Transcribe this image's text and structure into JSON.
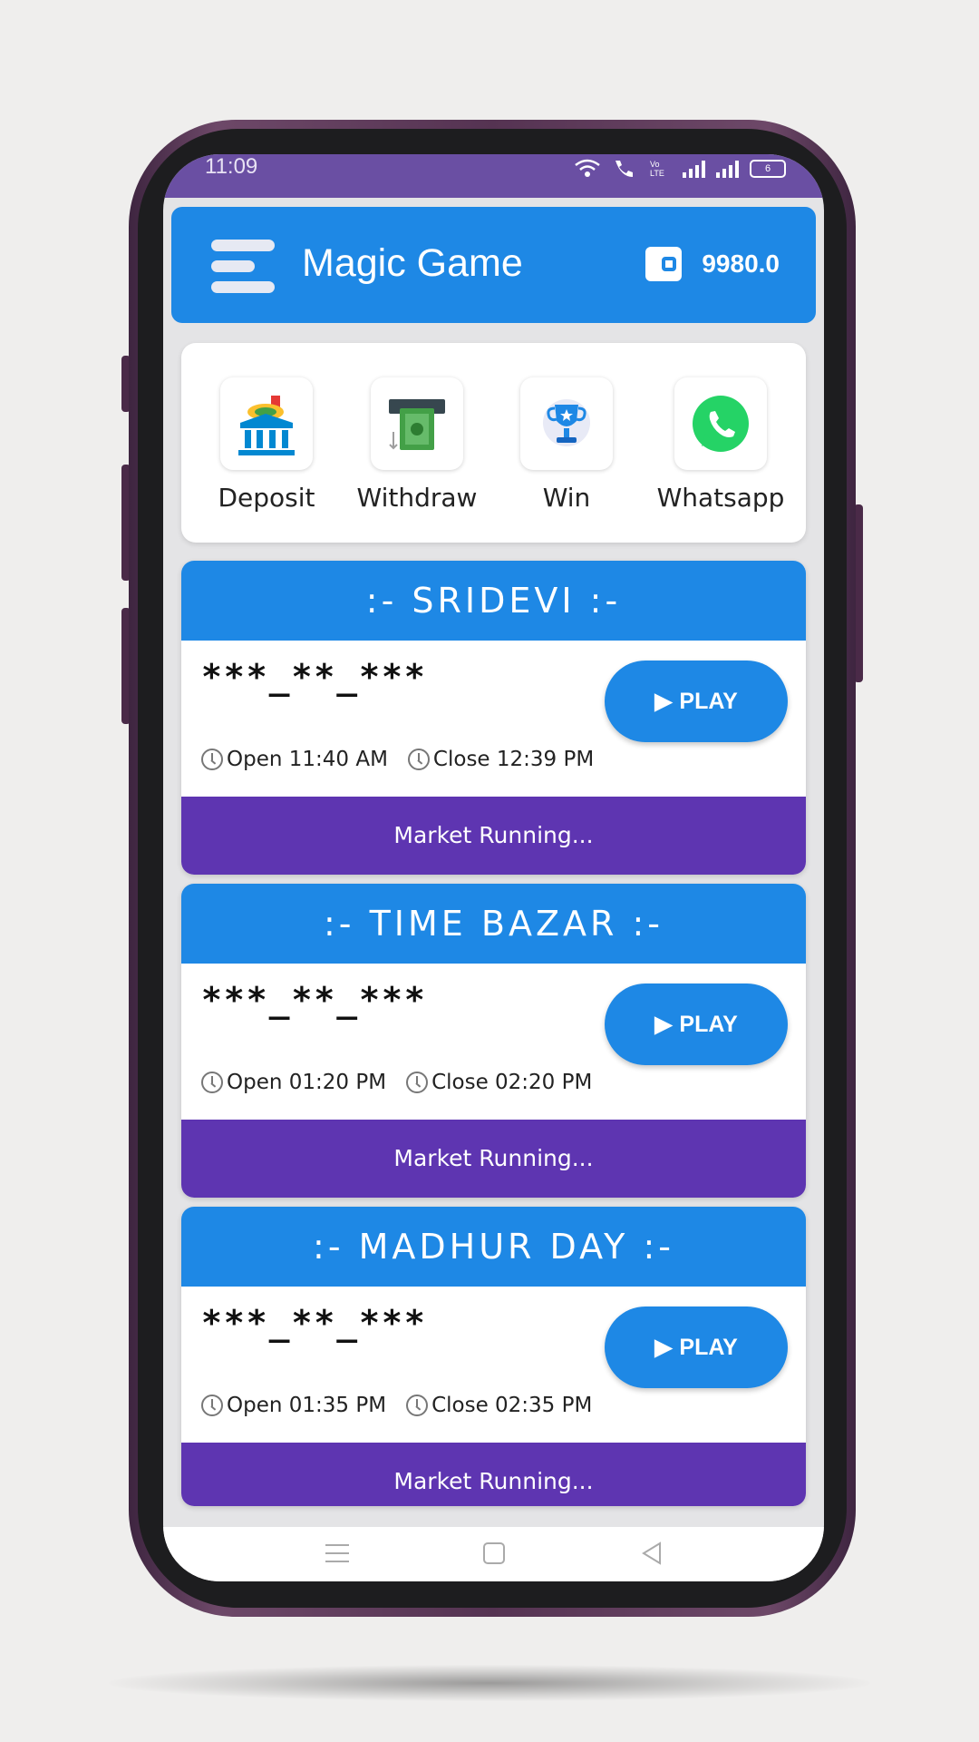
{
  "statusbar": {
    "time": "11:09",
    "battery": "6"
  },
  "header": {
    "title": "Magic Game",
    "wallet_balance": "9980.0"
  },
  "quick_actions": [
    {
      "label": "Deposit",
      "icon": "bank-deposit-icon"
    },
    {
      "label": "Withdraw",
      "icon": "atm-cash-icon"
    },
    {
      "label": "Win",
      "icon": "trophy-icon"
    },
    {
      "label": "Whatsapp",
      "icon": "whatsapp-icon"
    }
  ],
  "markets": [
    {
      "name": ":- SRIDEVI :-",
      "result": "***_**_***",
      "open": "Open 11:40 AM",
      "close": "Close 12:39 PM",
      "play": "PLAY",
      "status": "Market Running..."
    },
    {
      "name": ":- TIME BAZAR :-",
      "result": "***_**_***",
      "open": "Open 01:20 PM",
      "close": "Close 02:20 PM",
      "play": "PLAY",
      "status": "Market Running..."
    },
    {
      "name": ":- MADHUR DAY :-",
      "result": "***_**_***",
      "open": "Open 01:35 PM",
      "close": "Close 02:35 PM",
      "play": "PLAY",
      "status": "Market Running..."
    }
  ],
  "colors": {
    "primary": "#1e88e5",
    "status_bar": "#6a4fa3",
    "market_status": "#5e35b1",
    "whatsapp": "#25d366"
  }
}
